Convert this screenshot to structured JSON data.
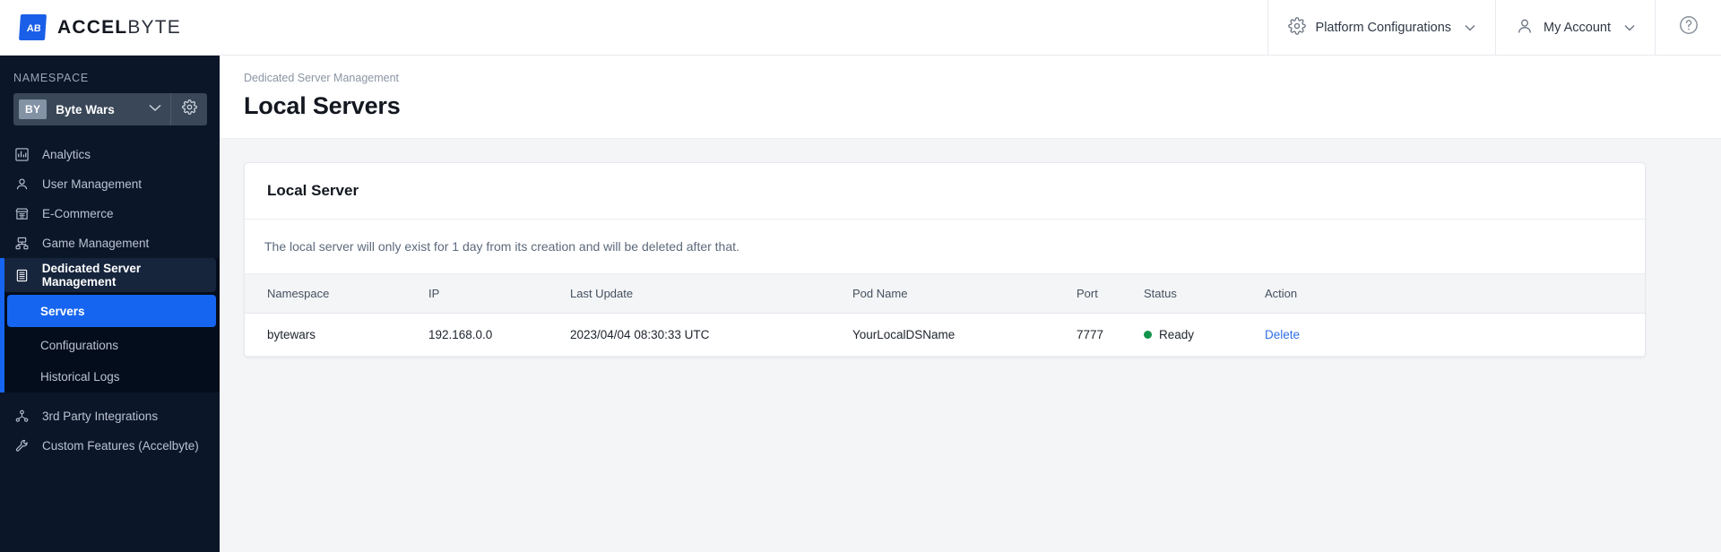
{
  "brand": {
    "name_bold": "ACCEL",
    "name_light": "BYTE",
    "logo_icon": "accelbyte-logo-icon"
  },
  "topbar": {
    "platform_configurations": "Platform Configurations",
    "my_account": "My Account",
    "gear_icon": "gear-icon",
    "user_icon": "user-icon",
    "help_icon": "question-circle-icon",
    "chevron": "⌄"
  },
  "sidebar": {
    "namespace_label": "NAMESPACE",
    "namespace": {
      "badge": "BY",
      "name": "Byte Wars",
      "chevron_icon": "chevron-down-icon",
      "settings_icon": "gear-icon"
    },
    "items": [
      {
        "label": "Analytics",
        "icon": "chart-bar-icon"
      },
      {
        "label": "User Management",
        "icon": "user-icon"
      },
      {
        "label": "E-Commerce",
        "icon": "store-icon"
      },
      {
        "label": "Game Management",
        "icon": "server-rack-icon"
      }
    ],
    "active_group": {
      "label": "Dedicated Server Management",
      "icon": "server-icon"
    },
    "sub_items": [
      {
        "label": "Servers",
        "active": true
      },
      {
        "label": "Configurations",
        "active": false
      },
      {
        "label": "Historical Logs",
        "active": false
      }
    ],
    "tail_items": [
      {
        "label": "3rd Party Integrations",
        "icon": "integrations-icon"
      },
      {
        "label": "Custom Features (Accelbyte)",
        "icon": "wrench-icon"
      }
    ]
  },
  "page": {
    "breadcrumb": "Dedicated Server Management",
    "title": "Local Servers"
  },
  "card": {
    "title": "Local Server",
    "note": "The local server will only exist for 1 day from its creation and will be deleted after that.",
    "columns": [
      "Namespace",
      "IP",
      "Last Update",
      "Pod Name",
      "Port",
      "Status",
      "Action"
    ],
    "rows": [
      {
        "namespace": "bytewars",
        "ip": "192.168.0.0",
        "last_update": "2023/04/04 08:30:33 UTC",
        "pod_name": "YourLocalDSName",
        "port": "7777",
        "status": "Ready",
        "action": "Delete"
      }
    ]
  },
  "colors": {
    "accent_blue": "#1565f0",
    "sidebar_bg": "#0b1628",
    "status_green": "#12944a",
    "link_blue": "#2f6fe4"
  }
}
